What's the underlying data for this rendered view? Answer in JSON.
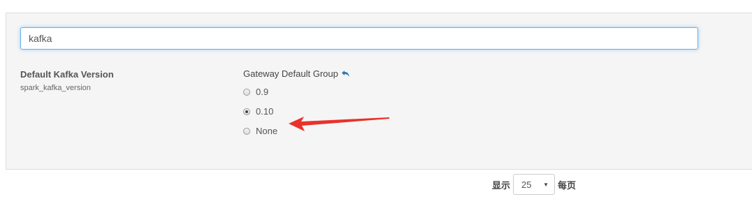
{
  "search": {
    "value": "kafka"
  },
  "setting": {
    "label": "Default Kafka Version",
    "key": "spark_kafka_version",
    "group_header": "Gateway Default Group",
    "options": [
      {
        "label": "0.9",
        "selected": false
      },
      {
        "label": "0.10",
        "selected": true
      },
      {
        "label": "None",
        "selected": false
      }
    ]
  },
  "pagination": {
    "show_label": "显示",
    "per_page_value": "25",
    "per_page_suffix": "每页"
  },
  "icons": {
    "revert": "undo-arrow-icon",
    "annotation": "red-arrow-annotation"
  },
  "colors": {
    "focus_border": "#66afe9",
    "revert_icon": "#2a7ab0",
    "annotation_arrow": "#e8322a"
  }
}
